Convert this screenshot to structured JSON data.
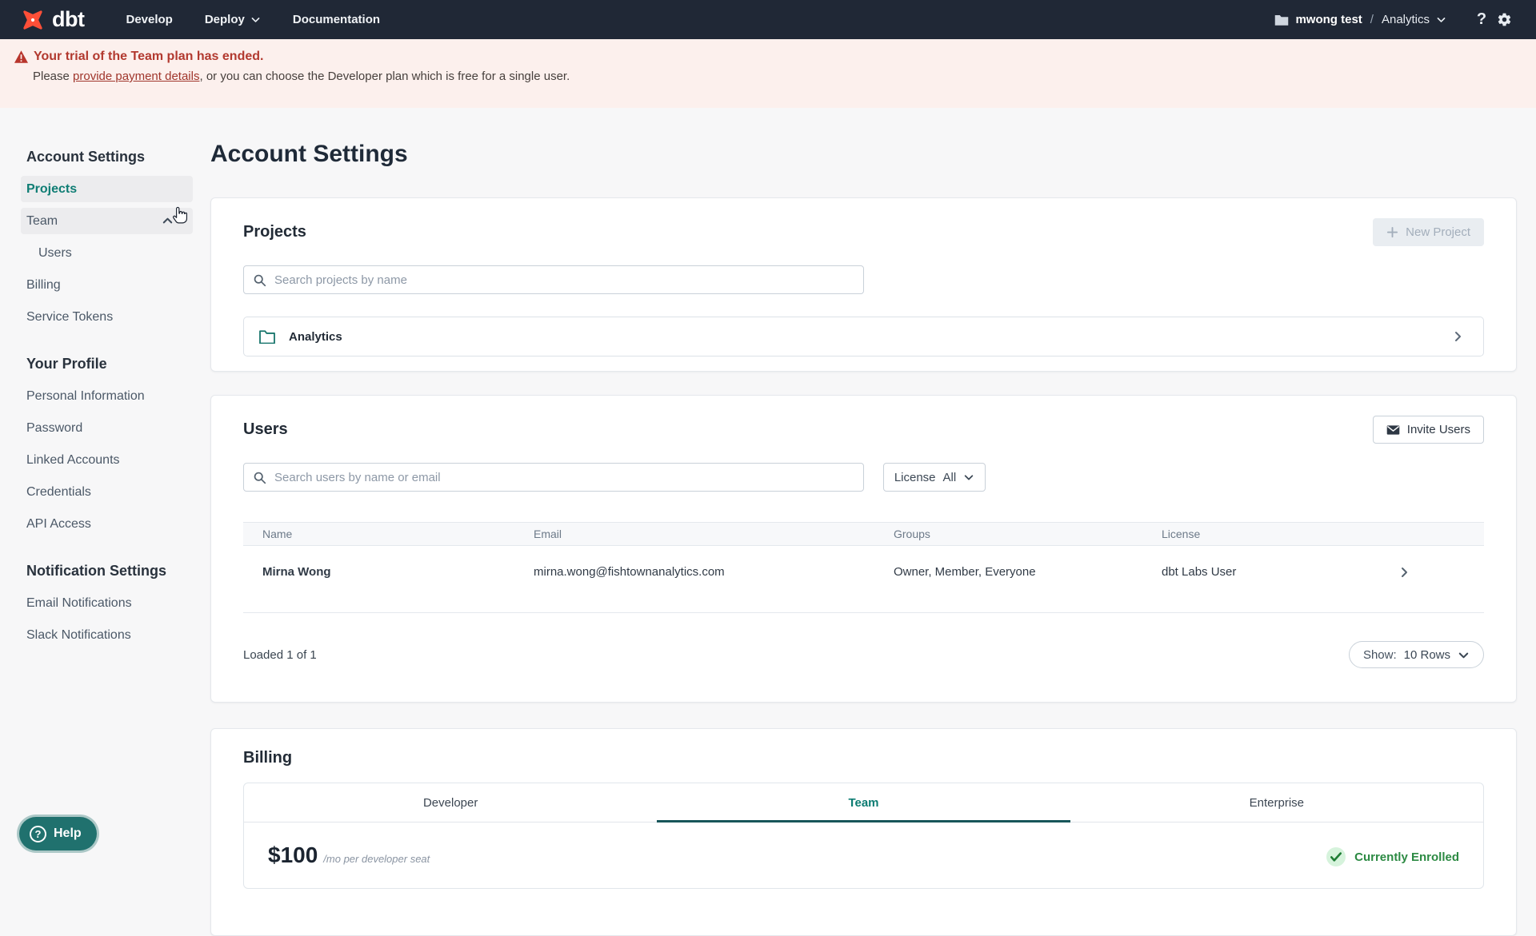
{
  "colors": {
    "accent_teal": "#0f7d74",
    "brand_orange": "#ff4f38",
    "alert_red": "#b2392f",
    "success_green": "#2c8a43",
    "topbar_navy": "#202836"
  },
  "nav": {
    "brand": "dbt",
    "items": [
      "Develop",
      "Deploy",
      "Documentation"
    ],
    "account": "mwong test",
    "separator": "/",
    "project": "Analytics"
  },
  "banner": {
    "title": "Your trial of the Team plan has ended.",
    "body_prefix": "Please ",
    "link": "provide payment details",
    "body_suffix": ", or you can choose the Developer plan which is free for a single user."
  },
  "sidebar": {
    "sections": [
      {
        "heading": "Account Settings",
        "items": [
          {
            "label": "Projects"
          },
          {
            "label": "Team"
          },
          {
            "label": "Users"
          },
          {
            "label": "Billing"
          },
          {
            "label": "Service Tokens"
          }
        ]
      },
      {
        "heading": "Your Profile",
        "items": [
          {
            "label": "Personal Information"
          },
          {
            "label": "Password"
          },
          {
            "label": "Linked Accounts"
          },
          {
            "label": "Credentials"
          },
          {
            "label": "API Access"
          }
        ]
      },
      {
        "heading": "Notification Settings",
        "items": [
          {
            "label": "Email Notifications"
          },
          {
            "label": "Slack Notifications"
          }
        ]
      }
    ]
  },
  "main": {
    "page_title": "Account Settings",
    "projects": {
      "title": "Projects",
      "new_project_button": "New Project",
      "search_placeholder": "Search projects by name",
      "rows": [
        {
          "name": "Analytics"
        }
      ]
    },
    "users": {
      "title": "Users",
      "invite_button": "Invite Users",
      "search_placeholder": "Search users by name or email",
      "license_filter": {
        "label": "License",
        "value": "All"
      },
      "table": {
        "headers": [
          "Name",
          "Email",
          "Groups",
          "License"
        ],
        "rows": [
          {
            "name": "Mirna Wong",
            "email": "mirna.wong@fishtownanalytics.com",
            "groups": "Owner, Member, Everyone",
            "license": "dbt Labs User"
          }
        ]
      },
      "loaded_text": "Loaded 1 of 1",
      "show": {
        "label": "Show:",
        "value": "10 Rows"
      }
    },
    "billing": {
      "title": "Billing",
      "tabs": [
        "Developer",
        "Team",
        "Enterprise"
      ],
      "active_tab": "Team",
      "price": "$100",
      "price_suffix": "/mo per developer seat",
      "enrolled_badge": "Currently Enrolled"
    }
  },
  "help_button": {
    "label": "Help"
  }
}
